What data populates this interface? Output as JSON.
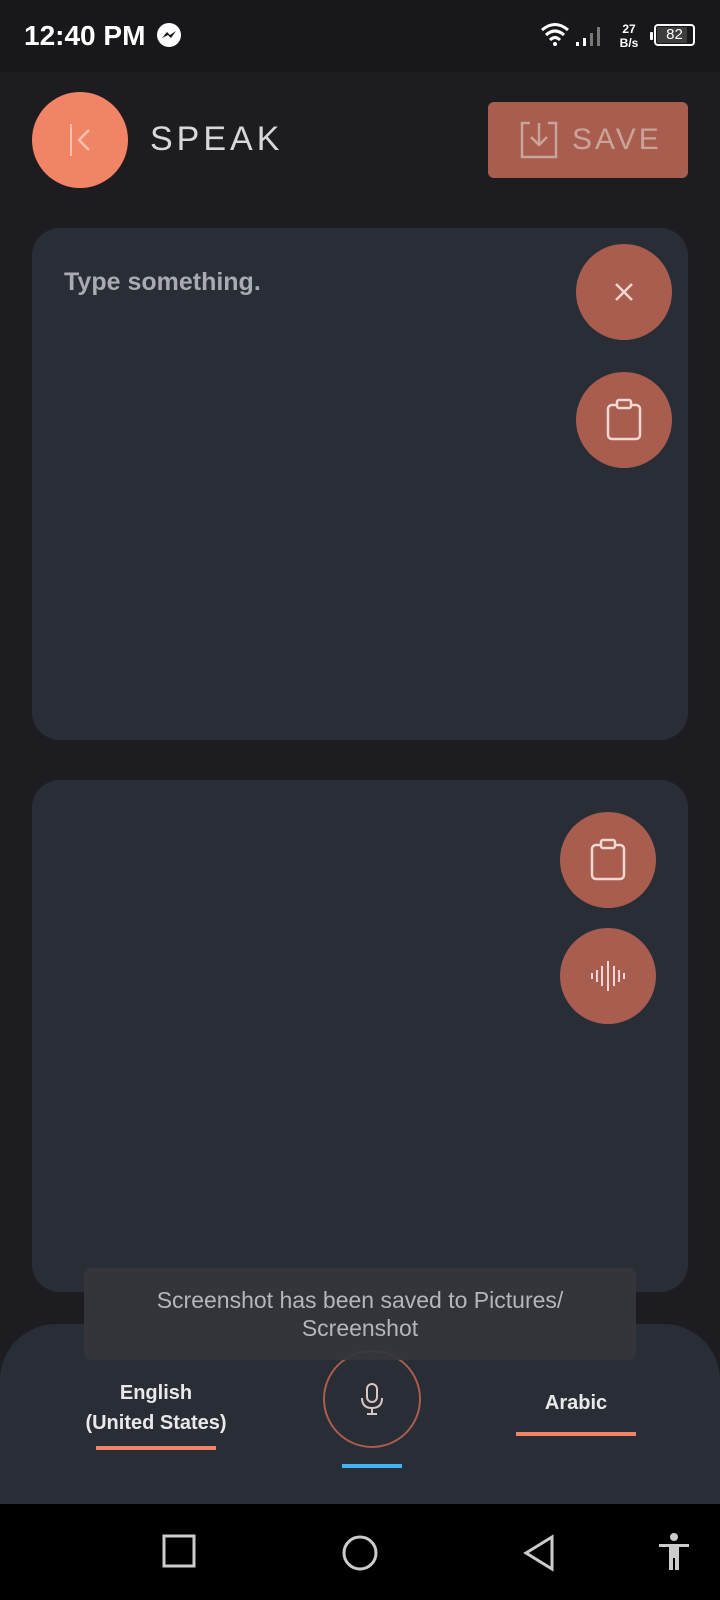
{
  "status_bar": {
    "time": "12:40 PM",
    "net_speed_value": "27",
    "net_speed_unit": "B/s",
    "battery": "82"
  },
  "header": {
    "title": "SPEAK",
    "save_label": "SAVE"
  },
  "input_panel": {
    "placeholder": "Type something."
  },
  "toast": {
    "line1": "Screenshot has been saved to  Pictures/",
    "line2": "Screenshot"
  },
  "languages": {
    "source_line1": "English",
    "source_line2": "(United States)",
    "target": "Arabic"
  },
  "colors": {
    "accent": "#f28466",
    "button": "#a85d4f",
    "panel": "#292d36",
    "background": "#1d1d21",
    "indicator": "#42b3f5"
  },
  "icons": [
    "messenger-icon",
    "wifi-icon",
    "signal-icon",
    "back-icon",
    "save-icon",
    "close-icon",
    "clipboard-icon",
    "waveform-icon",
    "mic-icon",
    "recents-icon",
    "home-icon",
    "back-nav-icon",
    "accessibility-icon"
  ]
}
